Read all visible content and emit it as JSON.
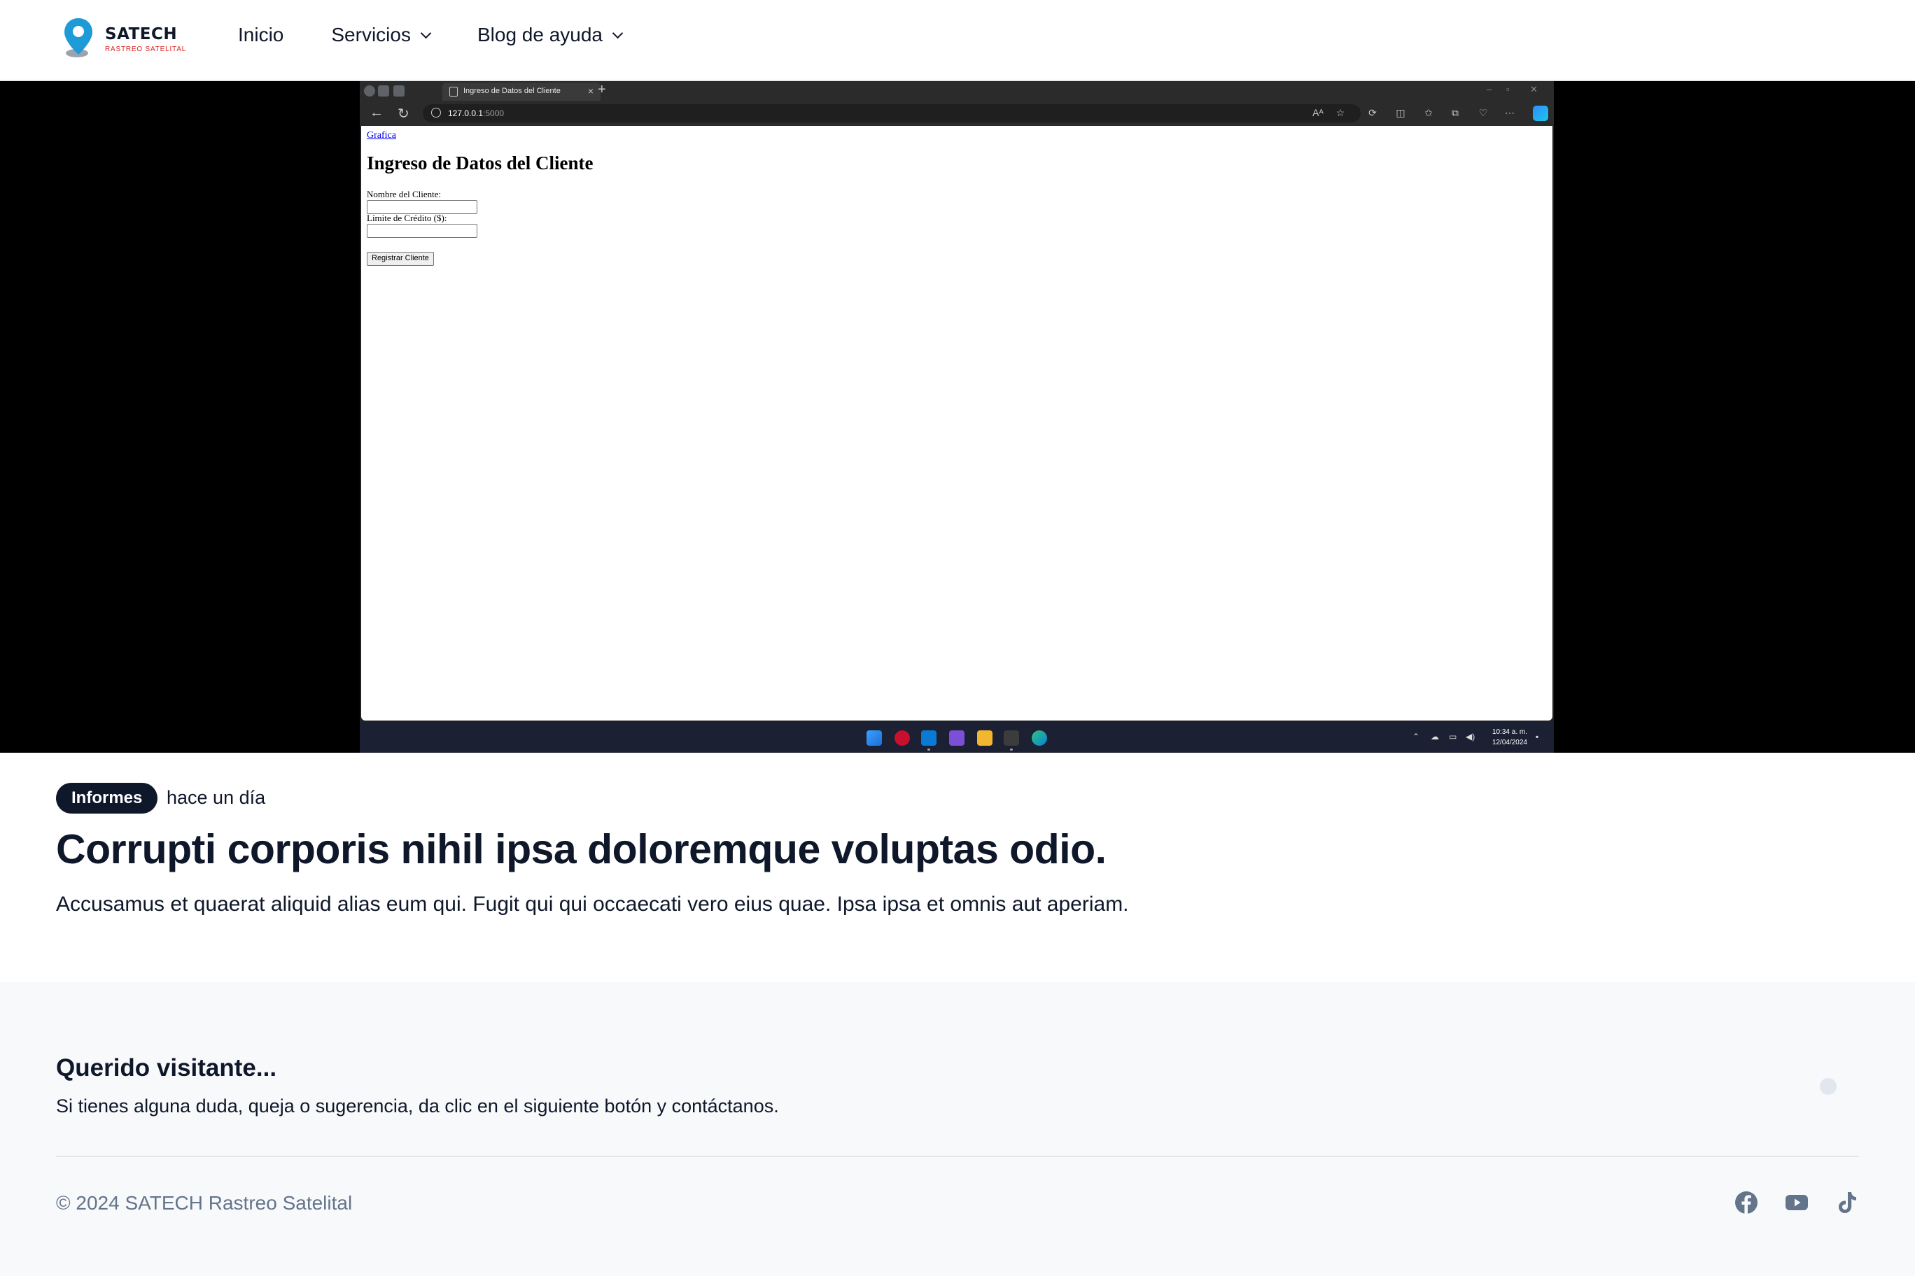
{
  "header": {
    "logo": {
      "name": "SATECH",
      "subtitle": "RASTREO SATELITAL"
    },
    "nav": [
      {
        "label": "Inicio",
        "dropdown": false
      },
      {
        "label": "Servicios",
        "dropdown": true
      },
      {
        "label": "Blog de ayuda",
        "dropdown": true
      }
    ]
  },
  "screenshot": {
    "tab_title": "Ingreso de Datos del Cliente",
    "url_host": "127.0.0.1",
    "url_port": ":5000",
    "page": {
      "link": "Grafica",
      "heading": "Ingreso de Datos del Cliente",
      "field1_label": "Nombre del Cliente:",
      "field2_label": "Límite de Crédito ($):",
      "submit": "Registrar Cliente"
    },
    "clock_time": "10:34 a. m.",
    "clock_date": "12/04/2024"
  },
  "article": {
    "category": "Informes",
    "date": "hace un día",
    "title": "Corrupti corporis nihil ipsa doloremque voluptas odio.",
    "lead": "Accusamus et quaerat aliquid alias eum qui. Fugit qui qui occaecati vero eius quae. Ipsa ipsa et omnis aut aperiam."
  },
  "footer": {
    "title": "Querido visitante...",
    "text": "Si tienes alguna duda, queja o sugerencia, da clic en el siguiente botón y contáctanos.",
    "copyright": "© 2024 SATECH Rastreo Satelital",
    "social": [
      "facebook-icon",
      "youtube-icon",
      "tiktok-icon"
    ]
  },
  "colors": {
    "dark": "#0f172a",
    "muted": "#64748b",
    "footer_bg": "#f8f9fb",
    "brand_blue": "#1e9bd7",
    "brand_red": "#dc2626"
  }
}
